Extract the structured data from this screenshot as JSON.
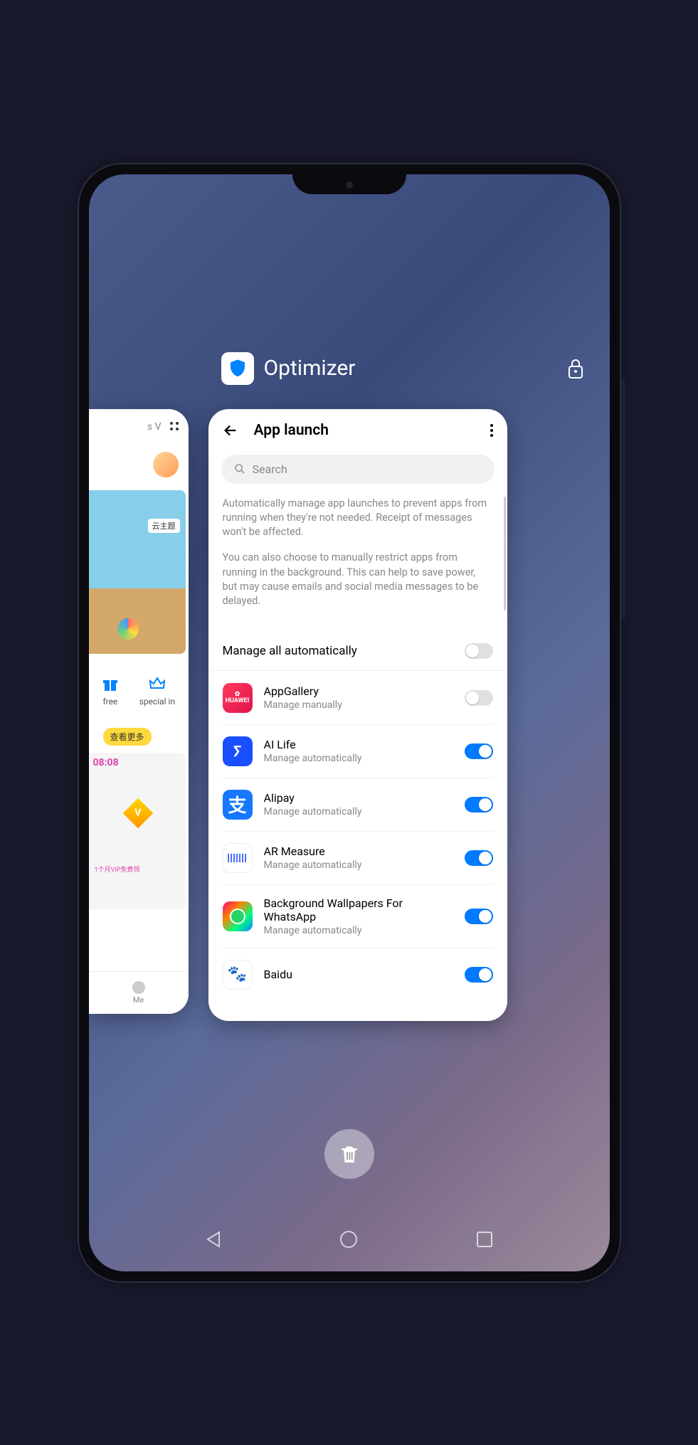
{
  "recents": {
    "app_name": "Optimizer"
  },
  "left_card": {
    "tabs": "s   V",
    "theme_tag": "云主题",
    "icons": [
      {
        "label": "free"
      },
      {
        "label": "special in"
      }
    ],
    "see_more": "查看更多",
    "clock": "08:08",
    "vip_text": "1个月VIP免费领",
    "nav_me": "Me"
  },
  "main_card": {
    "title": "App launch",
    "search_placeholder": "Search",
    "desc1": "Automatically manage app launches to prevent apps from running when they're not needed. Receipt of messages won't be affected.",
    "desc2": "You can also choose to manually restrict apps from running in the background. This can help to save power, but may cause emails and social media messages to be delayed.",
    "manage_all_label": "Manage all automatically",
    "manage_all_on": false,
    "apps": [
      {
        "name": "AppGallery",
        "sub": "Manage manually",
        "on": false,
        "icon": "red"
      },
      {
        "name": "AI Life",
        "sub": "Manage automatically",
        "on": true,
        "icon": "blue"
      },
      {
        "name": "Alipay",
        "sub": "Manage automatically",
        "on": true,
        "icon": "blue-alipay"
      },
      {
        "name": "AR Measure",
        "sub": "Manage automatically",
        "on": true,
        "icon": "white"
      },
      {
        "name": "Background Wallpapers For WhatsApp",
        "sub": "Manage automatically",
        "on": true,
        "icon": "rainbow"
      },
      {
        "name": "Baidu",
        "sub": "",
        "on": true,
        "icon": "white-paw"
      }
    ]
  }
}
